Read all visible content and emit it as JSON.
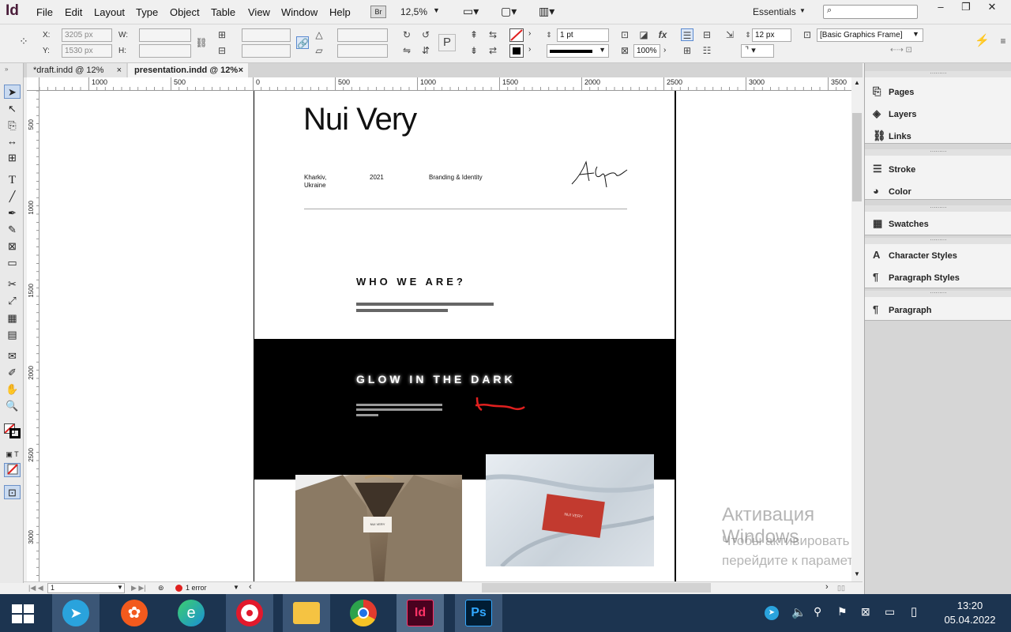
{
  "app": {
    "logo": "Id"
  },
  "menu": [
    "File",
    "Edit",
    "Layout",
    "Type",
    "Object",
    "Table",
    "View",
    "Window",
    "Help"
  ],
  "toolbar": {
    "bridge": "Br",
    "zoom": "12,5%",
    "workspace": "Essentials"
  },
  "control": {
    "x_label": "X:",
    "x_value": "3205 px",
    "y_label": "Y:",
    "y_value": "1530 px",
    "w_label": "W:",
    "h_label": "H:",
    "stroke_weight": "1 pt",
    "zoom_pct": "100%",
    "gap_value": "12 px",
    "frame_style": "[Basic Graphics Frame]"
  },
  "tabs": [
    {
      "label": "*draft.indd @ 12%",
      "close": "×"
    },
    {
      "label": "presentation.indd @ 12%",
      "close": "×"
    }
  ],
  "ruler_h": [
    {
      "label": "1000"
    },
    {
      "label": "500"
    },
    {
      "label": "0"
    },
    {
      "label": "500"
    },
    {
      "label": "1000"
    },
    {
      "label": "1500"
    },
    {
      "label": "2000"
    },
    {
      "label": "2500"
    },
    {
      "label": "3000"
    },
    {
      "label": "3500"
    }
  ],
  "ruler_v": [
    {
      "label": "500"
    },
    {
      "label": "1000"
    },
    {
      "label": "1500"
    },
    {
      "label": "2000"
    },
    {
      "label": "2500"
    },
    {
      "label": "3000"
    }
  ],
  "document": {
    "title": "Nui Very",
    "city": "Kharkiv,",
    "country": "Ukraine",
    "year": "2021",
    "service": "Branding & Identity",
    "section1": "WHO WE ARE?",
    "section2": "GLOW IN THE DARK",
    "label_text": "NUI VERY",
    "label_text2": "NUI VERY"
  },
  "status": {
    "page": "1",
    "errors": "1 error"
  },
  "panels": [
    {
      "group": 1,
      "items": [
        {
          "label": "Pages",
          "icon": "pages-icon"
        },
        {
          "label": "Layers",
          "icon": "layers-icon"
        },
        {
          "label": "Links",
          "icon": "links-icon"
        }
      ]
    },
    {
      "group": 2,
      "items": [
        {
          "label": "Stroke",
          "icon": "stroke-icon"
        },
        {
          "label": "Color",
          "icon": "color-icon"
        }
      ]
    },
    {
      "group": 3,
      "items": [
        {
          "label": "Swatches",
          "icon": "swatches-icon"
        }
      ]
    },
    {
      "group": 4,
      "items": [
        {
          "label": "Character Styles",
          "icon": "character-styles-icon"
        },
        {
          "label": "Paragraph Styles",
          "icon": "paragraph-styles-icon"
        }
      ]
    },
    {
      "group": 5,
      "items": [
        {
          "label": "Paragraph",
          "icon": "paragraph-icon"
        }
      ]
    }
  ],
  "watermark": {
    "line1": "Активация Windows",
    "line2": "Чтобы активировать Windows,",
    "line3": "перейдите к параметрам компьютера."
  },
  "clock": {
    "time": "13:20",
    "date": "05.04.2022"
  },
  "colors": {
    "accent_red": "#e0201f",
    "black_band": "#000000",
    "indesign": "#49021f"
  }
}
